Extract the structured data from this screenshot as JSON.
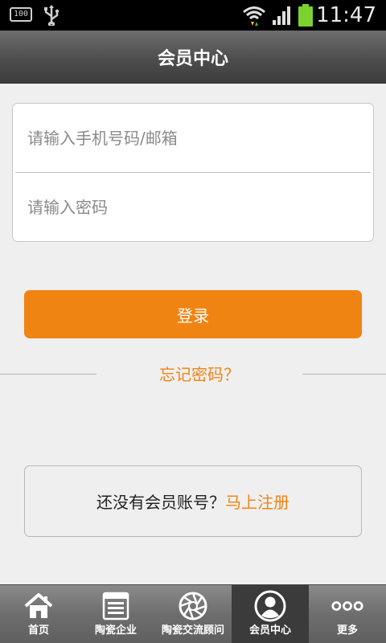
{
  "status_bar": {
    "battery_badge": "100",
    "time": "11:47"
  },
  "header": {
    "title": "会员中心"
  },
  "login_form": {
    "phone_placeholder": "请输入手机号码/邮箱",
    "password_placeholder": "请输入密码",
    "login_label": "登录",
    "forgot_label": "忘记密码？"
  },
  "register": {
    "prompt": "还没有会员账号？",
    "link": "马上注册"
  },
  "tabs": [
    {
      "label": "首页",
      "icon": "home-icon"
    },
    {
      "label": "陶瓷企业",
      "icon": "document-list-icon"
    },
    {
      "label": "陶瓷交流顾问",
      "icon": "aperture-icon"
    },
    {
      "label": "会员中心",
      "icon": "user-icon",
      "active": true
    },
    {
      "label": "更多",
      "icon": "more-dots-icon"
    }
  ],
  "colors": {
    "accent": "#f08413",
    "header": "#555555",
    "background": "#efefef"
  }
}
